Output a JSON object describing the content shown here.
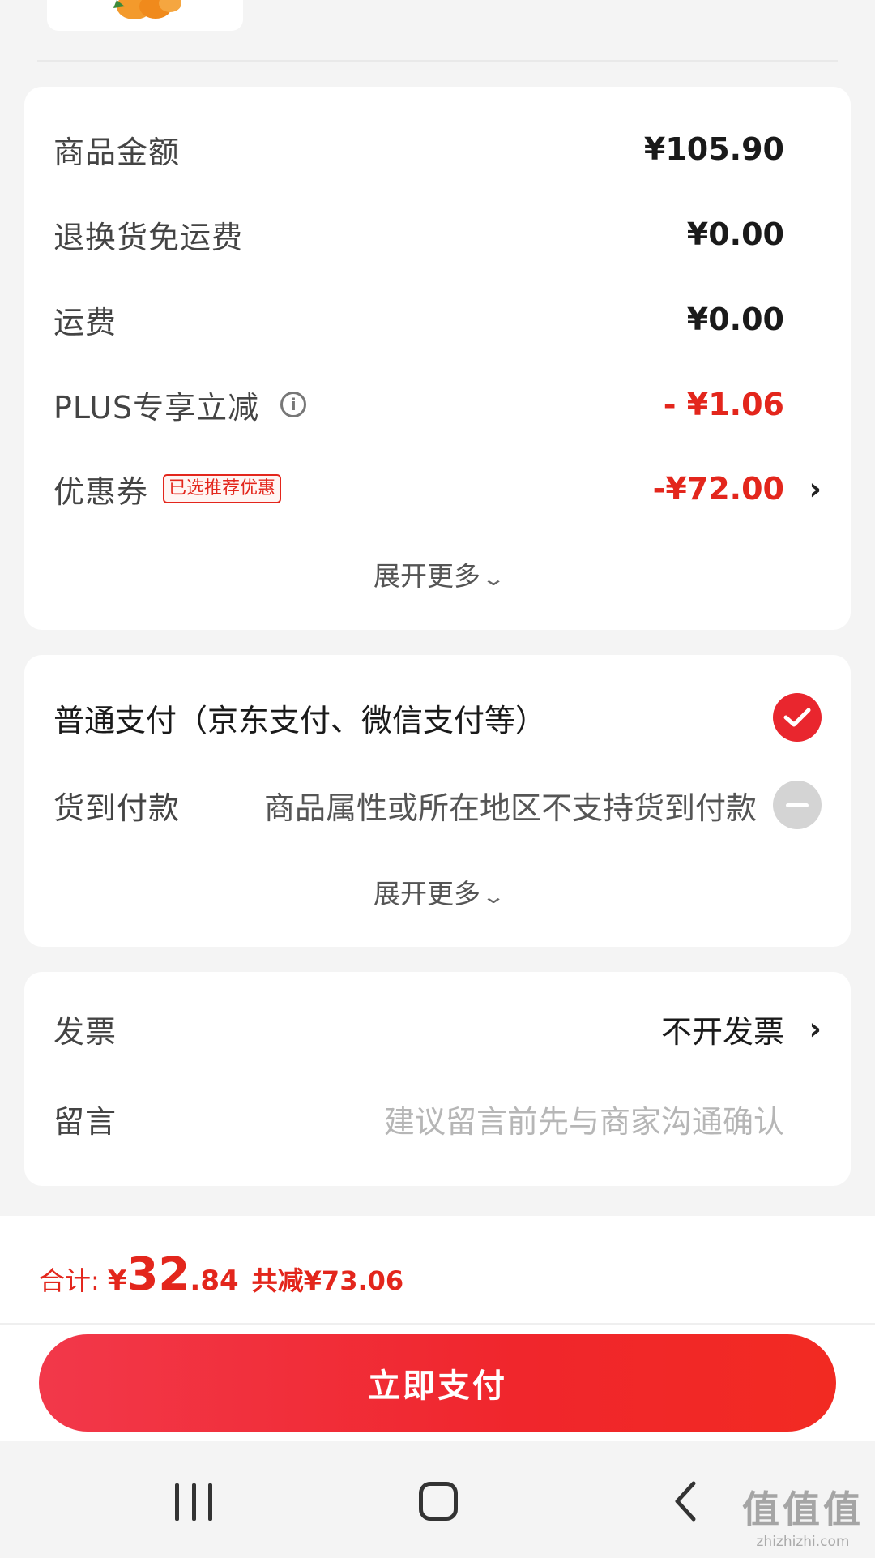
{
  "price_summary": {
    "rows": [
      {
        "label": "商品金额",
        "value": "¥105.90"
      },
      {
        "label": "退换货免运费",
        "value": "¥0.00"
      },
      {
        "label": "运费",
        "value": "¥0.00"
      },
      {
        "label": "PLUS专享立减",
        "value": "- ¥1.06"
      },
      {
        "label": "优惠券",
        "tag": "已选推荐优惠",
        "value": "-¥72.00"
      }
    ],
    "expand_label": "展开更多"
  },
  "payment": {
    "standard_label": "普通支付（京东支付、微信支付等）",
    "cod_label": "货到付款",
    "cod_desc": "商品属性或所在地区不支持货到付款",
    "expand_label": "展开更多"
  },
  "extras": {
    "invoice_label": "发票",
    "invoice_value": "不开发票",
    "note_label": "留言",
    "note_placeholder": "建议留言前先与商家沟通确认"
  },
  "footer": {
    "total_label": "合计:",
    "currency": "¥",
    "total_integer": "32",
    "total_decimal": ".84",
    "saved_label": "共减",
    "saved_amount": "¥73.06",
    "pay_button": "立即支付"
  },
  "watermark": {
    "big": "值值值",
    "small": "zhizhizhi.com"
  },
  "colors": {
    "accent": "#e3261c",
    "button": "#f0262c"
  },
  "icons": {
    "info": "info-icon",
    "chevron": "chevron-right-icon",
    "check": "check-circle-icon",
    "disabled": "minus-circle-icon"
  }
}
